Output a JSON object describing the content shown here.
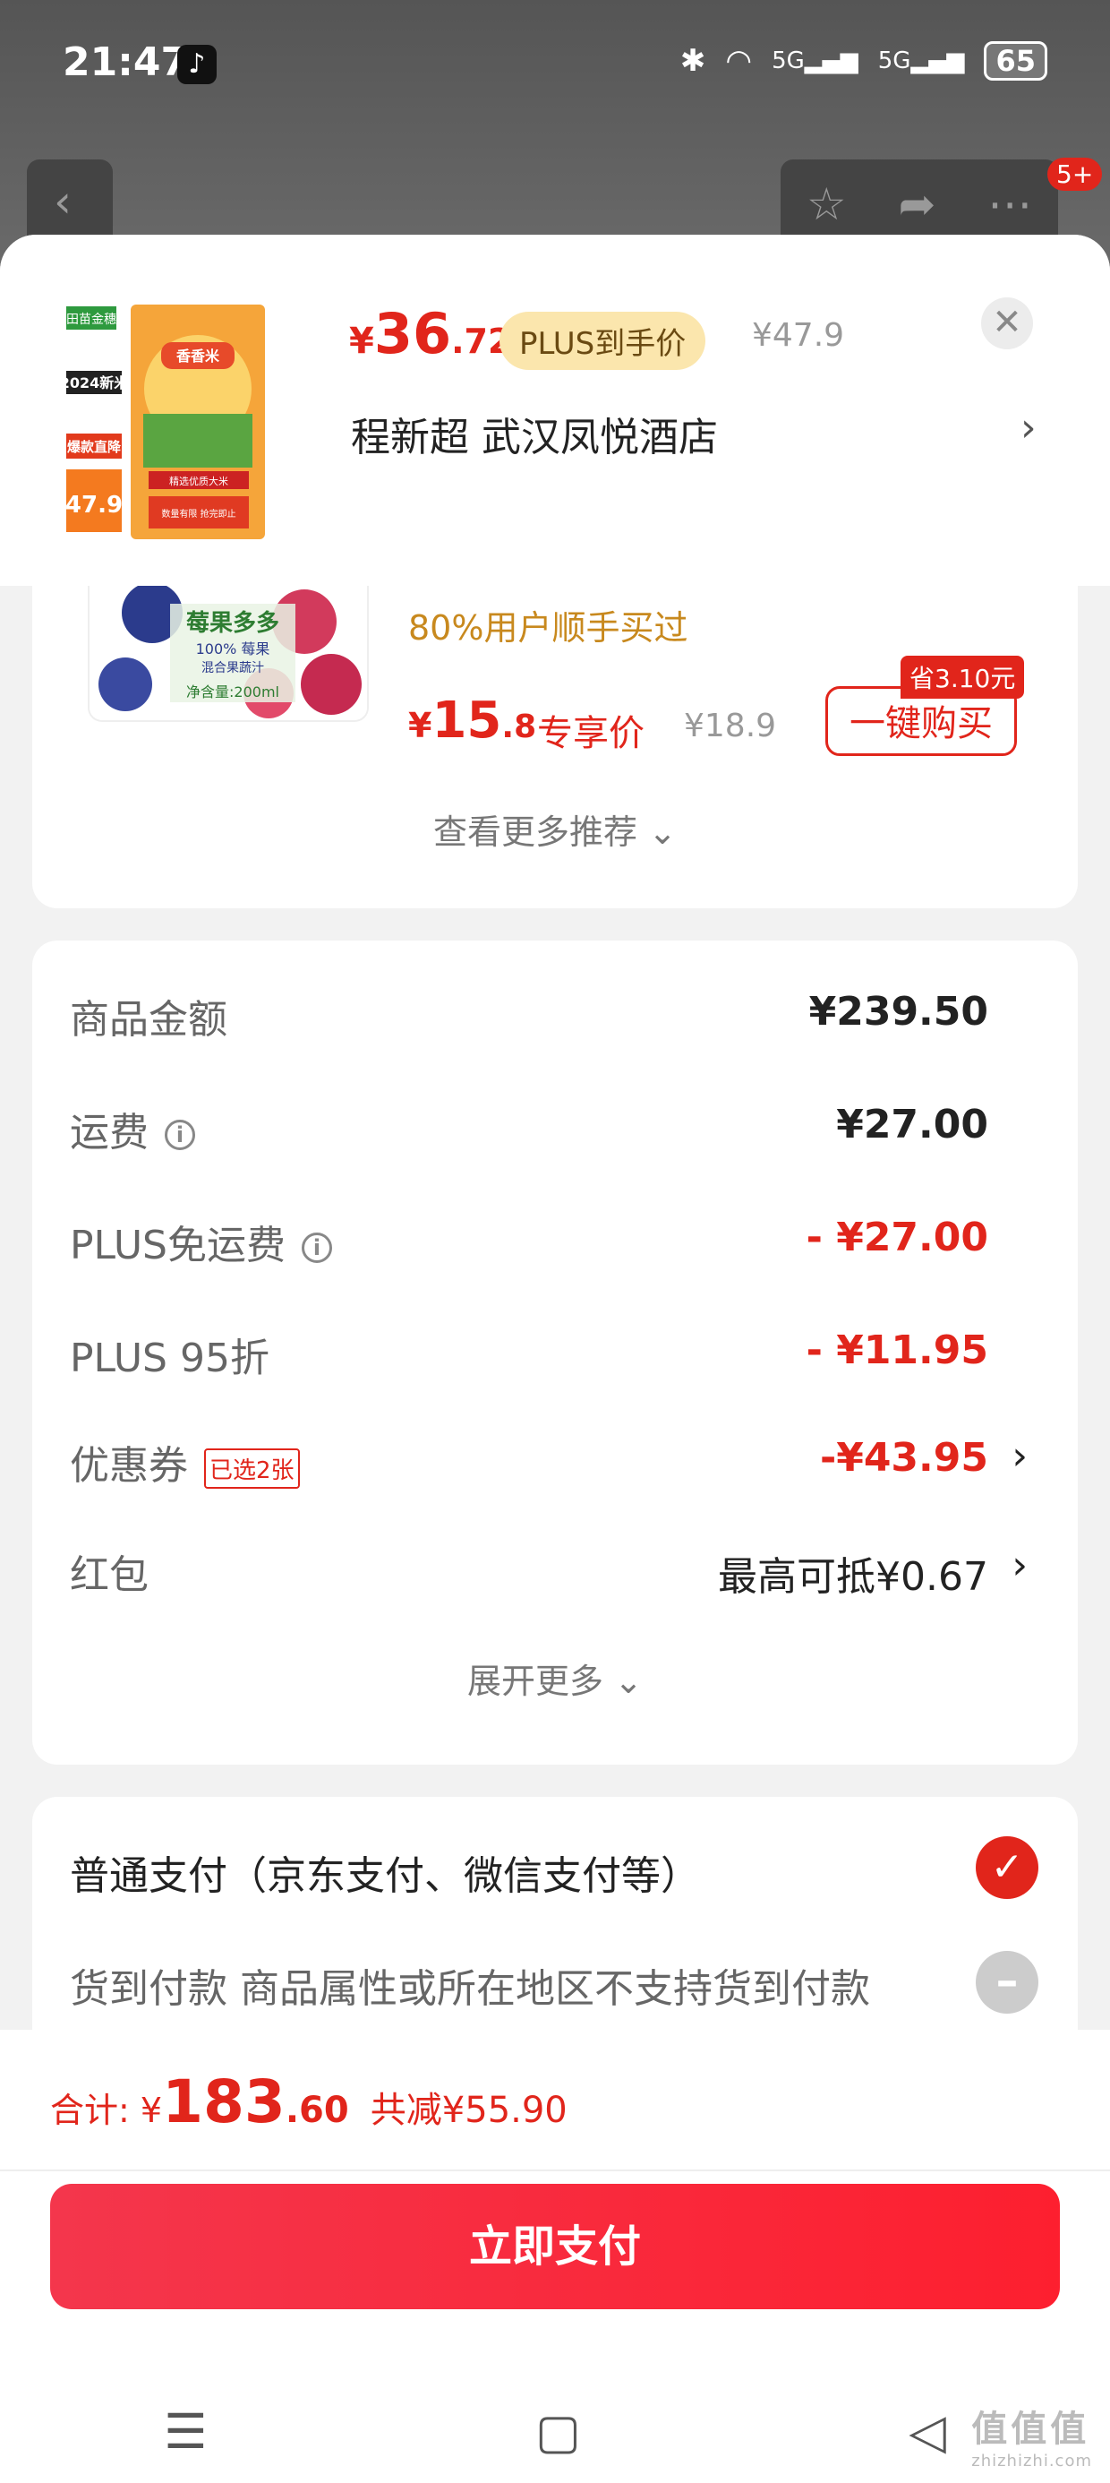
{
  "status_bar": {
    "time": "21:47",
    "battery": "65",
    "signal_1": "5G",
    "signal_2": "5G"
  },
  "top_nav": {
    "cart_badge": "5+"
  },
  "product": {
    "thumb_text": {
      "brand": "田苗金穗",
      "title": "2024新米",
      "promo": "爆款直降",
      "price": "47.9",
      "pack": "香香米",
      "seal_1": "精选优质大米",
      "seal_2": "数量有限 抢完即止"
    },
    "price_yen": "¥",
    "price_int": "36",
    "price_dec": ".72",
    "plus_tag": "PLUS到手价",
    "orig_price": "¥47.9",
    "address": "程新超  武汉凤悦酒店"
  },
  "recommend": {
    "img_text": {
      "title": "莓果多多",
      "sub": "100% 莓果",
      "sub2": "混合果蔬汁",
      "volume": "净含量:200ml"
    },
    "sold_text": "80%用户顺手买过",
    "price_yen": "¥",
    "price_int": "15",
    "price_dec": ".8",
    "exclusive": "专享价",
    "orig_price": "¥18.9",
    "save_badge": "省3.10元",
    "buy_button": "一键购买",
    "more_label": "查看更多推荐 ⌄"
  },
  "summary": {
    "rows": [
      {
        "label": "商品金额",
        "value": "¥239.50"
      },
      {
        "label": "运费",
        "value": "¥27.00"
      },
      {
        "label": "PLUS免运费",
        "value": "- ¥27.00"
      },
      {
        "label": "PLUS 95折",
        "value": "- ¥11.95"
      },
      {
        "label": "优惠券",
        "tag": "已选2张",
        "value": "-¥43.95"
      },
      {
        "label": "红包",
        "value": "最高可抵¥0.67"
      }
    ],
    "expand_label": "展开更多 ⌄"
  },
  "payment": {
    "option_1": "普通支付（京东支付、微信支付等）",
    "option_2": "货到付款   商品属性或所在地区不支持货到付款"
  },
  "footer": {
    "total_label": "合计: ¥",
    "total_int": "183",
    "total_dec": ".60",
    "discount": "共减¥55.90",
    "pay_button": "立即支付"
  },
  "watermark": {
    "text": "值值值",
    "sub": "zhizhizhi.com"
  },
  "colors": {
    "accent": "#e1251b",
    "plus_bg": "#fbe6ad",
    "sold": "#c8891e"
  }
}
